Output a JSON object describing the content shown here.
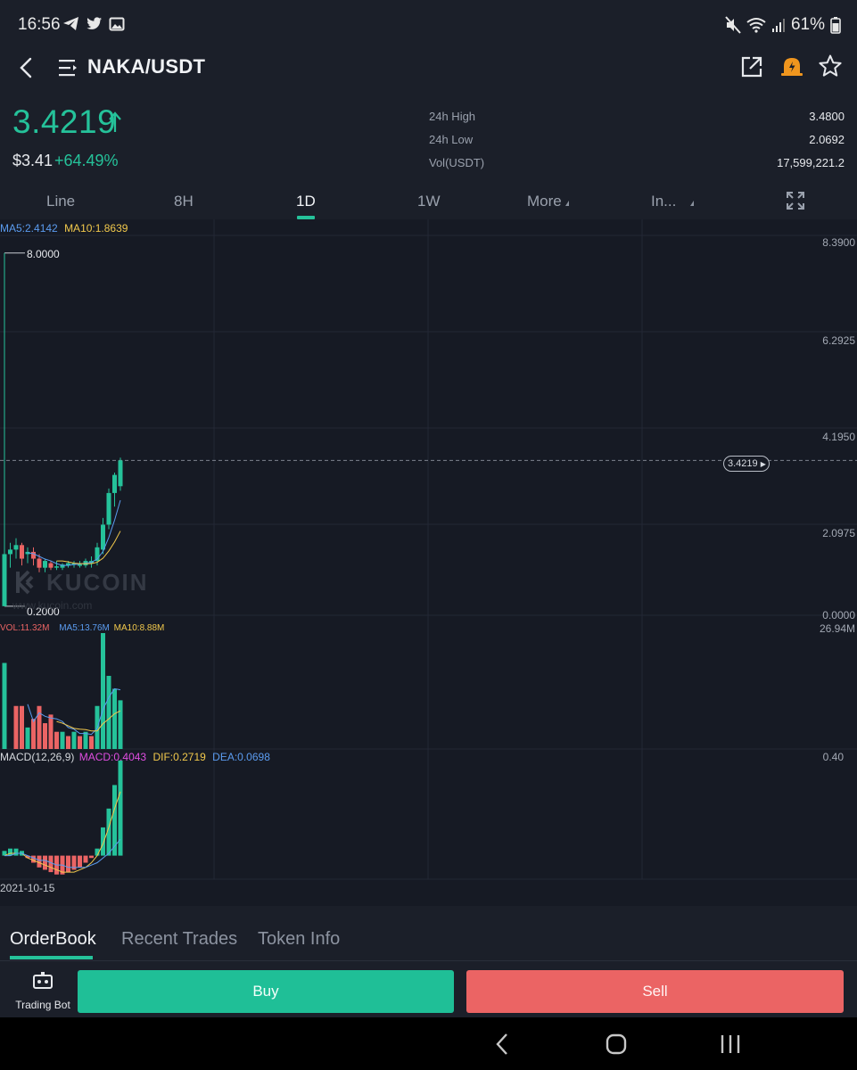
{
  "status_bar": {
    "time": "16:56",
    "left_icons": [
      "telegram-icon",
      "twitter-icon",
      "image-icon"
    ],
    "right_icons": [
      "mute-icon",
      "wifi-icon",
      "signal-icon"
    ],
    "battery": "61%"
  },
  "header": {
    "pair": "NAKA/USDT",
    "icons": [
      "back-icon",
      "menu-icon",
      "share-icon",
      "price-alert-icon",
      "star-icon"
    ],
    "alert_color": "#f0961e"
  },
  "price": {
    "last": "3.4219",
    "usd": "$3.41",
    "change": "+64.49%",
    "up_color": "#25c29a",
    "down_color": "#eb6464"
  },
  "stats": [
    {
      "label": "24h High",
      "value": "3.4800"
    },
    {
      "label": "24h Low",
      "value": "2.0692"
    },
    {
      "label": "Vol(USDT)",
      "value": "17,599,221.2"
    }
  ],
  "intervals": {
    "tabs": [
      "Line",
      "8H",
      "1D",
      "1W",
      "More",
      "In..."
    ],
    "active": "1D"
  },
  "chart_data": {
    "type": "candlestick",
    "ma_legend": {
      "ma5": "MA5:2.4142",
      "ma10": "MA10:1.8639"
    },
    "y_axis_labels": [
      "8.3900",
      "6.2925",
      "4.1950",
      "2.0975",
      "0.0000"
    ],
    "ylim": [
      0,
      8.39
    ],
    "max_marker": "8.0000",
    "min_marker": "0.2000",
    "current_price_tag": "3.4219",
    "watermark": "KUCOIN",
    "watermark_url": "www.kucoin.com",
    "candles": [
      {
        "o": 0.2,
        "h": 8.0,
        "l": 0.2,
        "c": 1.35
      },
      {
        "o": 1.35,
        "h": 1.6,
        "l": 1.05,
        "c": 1.45
      },
      {
        "o": 1.45,
        "h": 1.7,
        "l": 1.25,
        "c": 1.55
      },
      {
        "o": 1.55,
        "h": 1.6,
        "l": 1.1,
        "c": 1.25
      },
      {
        "o": 1.35,
        "h": 1.5,
        "l": 1.15,
        "c": 1.4
      },
      {
        "o": 1.4,
        "h": 1.5,
        "l": 1.1,
        "c": 1.25
      },
      {
        "o": 1.25,
        "h": 1.35,
        "l": 0.95,
        "c": 1.05
      },
      {
        "o": 1.05,
        "h": 1.25,
        "l": 0.95,
        "c": 1.2
      },
      {
        "o": 1.15,
        "h": 1.2,
        "l": 1.0,
        "c": 1.05
      },
      {
        "o": 1.05,
        "h": 1.2,
        "l": 1.0,
        "c": 1.08
      },
      {
        "o": 1.05,
        "h": 1.15,
        "l": 1.0,
        "c": 1.12
      },
      {
        "o": 1.1,
        "h": 1.2,
        "l": 1.05,
        "c": 1.15
      },
      {
        "o": 1.12,
        "h": 1.2,
        "l": 1.05,
        "c": 1.15
      },
      {
        "o": 1.1,
        "h": 1.2,
        "l": 1.05,
        "c": 1.12
      },
      {
        "o": 1.1,
        "h": 1.25,
        "l": 1.05,
        "c": 1.2
      },
      {
        "o": 1.15,
        "h": 1.3,
        "l": 1.05,
        "c": 1.2
      },
      {
        "o": 1.2,
        "h": 1.6,
        "l": 1.1,
        "c": 1.5
      },
      {
        "o": 1.45,
        "h": 2.15,
        "l": 1.35,
        "c": 2.0
      },
      {
        "o": 2.0,
        "h": 2.8,
        "l": 1.9,
        "c": 2.7
      },
      {
        "o": 2.7,
        "h": 3.15,
        "l": 2.4,
        "c": 3.1
      },
      {
        "o": 2.85,
        "h": 3.48,
        "l": 2.75,
        "c": 3.42
      }
    ],
    "ma5_values": [
      null,
      null,
      null,
      null,
      1.38,
      1.36,
      1.3,
      1.24,
      1.2,
      1.14,
      1.1,
      1.1,
      1.12,
      1.13,
      1.15,
      1.17,
      1.24,
      1.41,
      1.72,
      2.1,
      2.54
    ],
    "ma10_values": [
      null,
      null,
      null,
      null,
      null,
      null,
      null,
      null,
      null,
      1.2,
      1.2,
      1.18,
      1.15,
      1.14,
      1.14,
      1.14,
      1.17,
      1.26,
      1.42,
      1.62,
      1.86
    ],
    "volume": {
      "legend": {
        "vol": "VOL:11.32M",
        "ma5": "MA5:13.76M",
        "ma10": "MA10:8.88M"
      },
      "max_label": "26.94M",
      "ylim": [
        0,
        26.94
      ],
      "values": [
        20,
        0,
        10,
        10,
        5,
        7,
        10,
        6,
        8,
        4,
        4,
        3,
        4,
        3,
        4,
        3,
        10,
        26.94,
        17,
        14,
        11.32
      ],
      "up": [
        true,
        false,
        false,
        false,
        true,
        false,
        false,
        false,
        false,
        false,
        true,
        false,
        true,
        false,
        true,
        false,
        true,
        true,
        true,
        true,
        true
      ],
      "ma5_values": [
        null,
        null,
        null,
        null,
        10.4,
        6.4,
        8.4,
        7.6,
        7.2,
        7.0,
        6.4,
        5.0,
        4.6,
        3.6,
        3.6,
        3.4,
        4.8,
        9.2,
        12.0,
        14.0,
        13.76
      ],
      "ma10_values": [
        null,
        null,
        null,
        null,
        null,
        null,
        null,
        null,
        null,
        6.4,
        6.0,
        5.4,
        4.8,
        4.6,
        4.5,
        4.2,
        4.2,
        5.9,
        7.0,
        8.2,
        8.88
      ]
    },
    "macd": {
      "legend": {
        "name": "MACD(12,26,9)",
        "macd": "MACD:0.4043",
        "dif": "DIF:0.2719",
        "dea": "DEA:0.0698"
      },
      "max_label": "0.40",
      "ylim": [
        -0.1,
        0.4
      ],
      "hist": [
        0.02,
        0.03,
        0.03,
        0.02,
        -0.01,
        -0.03,
        -0.05,
        -0.06,
        -0.07,
        -0.08,
        -0.08,
        -0.07,
        -0.06,
        -0.05,
        -0.03,
        -0.01,
        0.03,
        0.12,
        0.2,
        0.3,
        0.4043
      ],
      "dif": [
        0.0,
        0.01,
        0.01,
        0.01,
        -0.01,
        -0.02,
        -0.03,
        -0.04,
        -0.05,
        -0.06,
        -0.07,
        -0.07,
        -0.07,
        -0.06,
        -0.05,
        -0.03,
        0.0,
        0.05,
        0.12,
        0.2,
        0.2719
      ],
      "dea": [
        0.0,
        0.0,
        0.01,
        0.01,
        0.0,
        -0.01,
        -0.02,
        -0.02,
        -0.03,
        -0.04,
        -0.04,
        -0.05,
        -0.05,
        -0.05,
        -0.05,
        -0.04,
        -0.03,
        -0.01,
        0.01,
        0.04,
        0.0698
      ]
    },
    "x_label": "2021-10-15"
  },
  "bottom_tabs": {
    "tabs": [
      "OrderBook",
      "Recent Trades",
      "Token Info"
    ],
    "active": "OrderBook"
  },
  "actions": {
    "bot_label": "Trading Bot",
    "buy": "Buy",
    "sell": "Sell"
  },
  "nav": [
    "nav-back-icon",
    "home-icon",
    "recents-icon"
  ]
}
